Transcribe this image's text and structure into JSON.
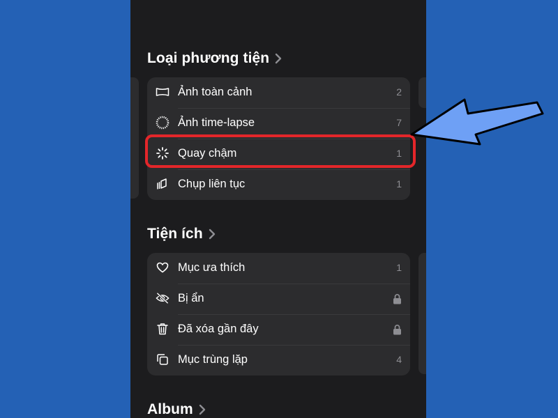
{
  "sections": {
    "media_types": {
      "title": "Loại phương tiện",
      "items": [
        {
          "label": "Ảnh toàn cảnh",
          "count": "2",
          "icon": "panorama-icon"
        },
        {
          "label": "Ảnh time-lapse",
          "count": "7",
          "icon": "timelapse-icon"
        },
        {
          "label": "Quay chậm",
          "count": "1",
          "icon": "slow-motion-icon"
        },
        {
          "label": "Chụp liên tục",
          "count": "1",
          "icon": "burst-icon"
        }
      ]
    },
    "utilities": {
      "title": "Tiện ích",
      "items": [
        {
          "label": "Mục ưa thích",
          "count": "1",
          "icon": "heart-icon"
        },
        {
          "label": "Bị ẩn",
          "locked": true,
          "icon": "eye-slash-icon"
        },
        {
          "label": "Đã xóa gần đây",
          "locked": true,
          "icon": "trash-icon"
        },
        {
          "label": "Mục trùng lặp",
          "count": "4",
          "icon": "duplicate-icon"
        }
      ]
    },
    "album": {
      "title": "Album"
    }
  },
  "annotation": {
    "highlight_color": "#e3262a",
    "arrow_color": "#6ea0f5",
    "highlighted_item": "Quay chậm"
  },
  "colors": {
    "background": "#2461b5",
    "phone_background": "#1c1c1e",
    "card": "#2c2c2e",
    "secondary_text": "#8e8e93"
  }
}
